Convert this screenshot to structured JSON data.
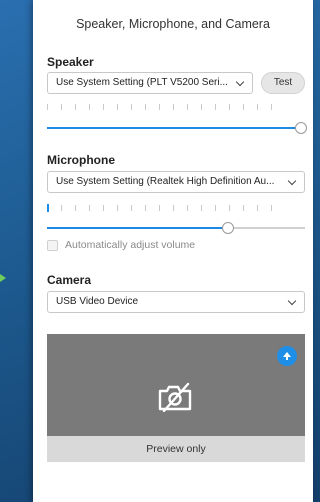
{
  "window": {
    "title": "Speaker, Microphone, and Camera"
  },
  "speaker": {
    "label": "Speaker",
    "device": "Use System Setting (PLT V5200 Seri...",
    "test_label": "Test",
    "level_fraction": 0.0,
    "volume_fraction": 1.0
  },
  "microphone": {
    "label": "Microphone",
    "device": "Use System Setting (Realtek High Definition Au...",
    "level_fraction": 0.02,
    "volume_fraction": 0.71,
    "auto_adjust_label": "Automatically adjust volume",
    "auto_adjust_checked": false
  },
  "camera": {
    "label": "Camera",
    "device": "USB Video Device",
    "preview_caption": "Preview only",
    "icons": [
      "camera-off-icon",
      "pin-icon"
    ]
  },
  "colors": {
    "accent": "#1e88e5",
    "preview_bg": "#7a7a7a",
    "caption_bg": "#d9d9d9"
  }
}
